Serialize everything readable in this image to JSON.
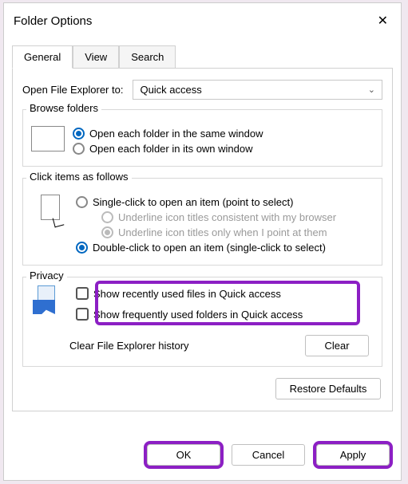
{
  "window": {
    "title": "Folder Options"
  },
  "tabs": [
    "General",
    "View",
    "Search"
  ],
  "active_tab": 0,
  "open_label": "Open File Explorer to:",
  "open_values": {
    "selected": "Quick access"
  },
  "browse": {
    "legend": "Browse folders",
    "opt_same": "Open each folder in the same window",
    "opt_own": "Open each folder in its own window",
    "selected": 0
  },
  "click": {
    "legend": "Click items as follows",
    "single": "Single-click to open an item (point to select)",
    "underline_browser": "Underline icon titles consistent with my browser",
    "underline_point": "Underline icon titles only when I point at them",
    "double": "Double-click to open an item (single-click to select)",
    "selected": "double",
    "sub_selected": "point"
  },
  "privacy": {
    "legend": "Privacy",
    "recent_files": "Show recently used files in Quick access",
    "frequent_folders": "Show frequently used folders in Quick access",
    "recent_checked": false,
    "frequent_checked": false,
    "clear_label": "Clear File Explorer history",
    "clear_btn": "Clear"
  },
  "restore_btn": "Restore Defaults",
  "footer": {
    "ok": "OK",
    "cancel": "Cancel",
    "apply": "Apply"
  }
}
